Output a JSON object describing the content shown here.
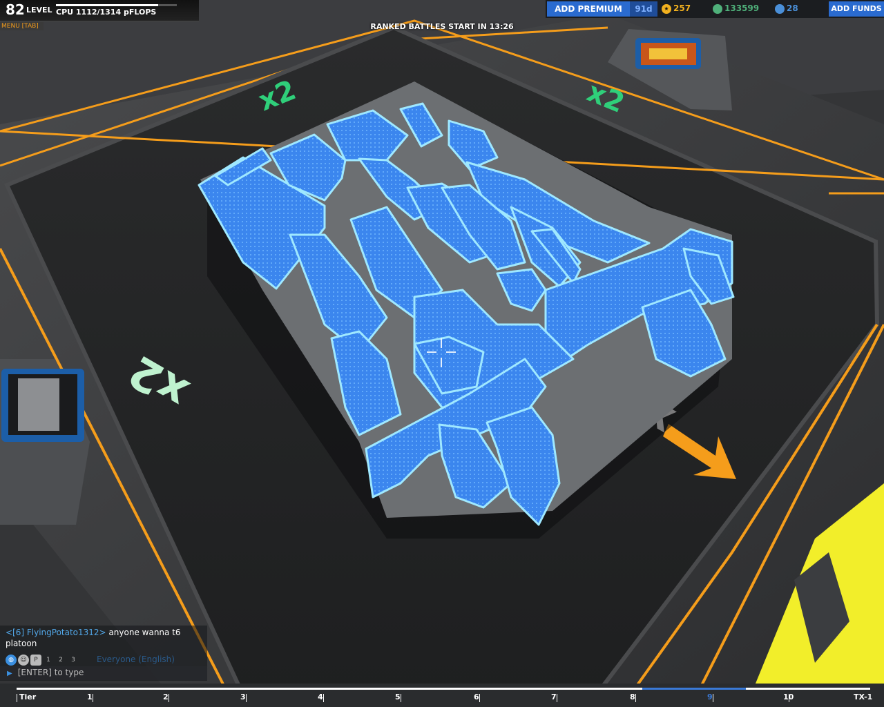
{
  "hud": {
    "level_value": "82",
    "level_label": "LEVEL",
    "cpu_text": "CPU 1112/1314 pFLOPS",
    "cpu_fraction": 0.846,
    "menu_label": "MENU [TAB]",
    "ranked_text": "RANKED BATTLES START IN 13:26",
    "add_premium_label": "ADD PREMIUM",
    "premium_days": "91d",
    "currencies": [
      {
        "icon": "star-icon",
        "value": "257",
        "color": "#f2b11f"
      },
      {
        "icon": "robits-icon",
        "value": "133599",
        "color": "#4fb07a"
      },
      {
        "icon": "galaxy-coin-icon",
        "value": "28",
        "color": "#4a8fd8"
      }
    ],
    "add_funds_label": "ADD FUNDS"
  },
  "floor_markings": [
    "x2",
    "x2",
    "x2",
    "x2"
  ],
  "chat": {
    "sender": "<[6] FlyingPotato1312>",
    "message": "anyone wanna t6 platoon",
    "channel": "Everyone (English)",
    "input_placeholder": "[ENTER] to type",
    "icons": [
      "globe-icon",
      "person-icon",
      "p-icon",
      "party-1-icon",
      "party-2-icon",
      "party-3-icon"
    ]
  },
  "tier_bar": {
    "start_label": "Tier",
    "end_label": "TX-1",
    "ticks": [
      "1",
      "2",
      "3",
      "4",
      "5",
      "6",
      "7",
      "8",
      "9",
      "10"
    ],
    "current_tier": "9"
  },
  "colors": {
    "accent_orange": "#f59d1b",
    "robot_blue": "#3f8ff0",
    "marking_green": "#2fcf7a",
    "premium_blue": "#2a6bd0"
  }
}
